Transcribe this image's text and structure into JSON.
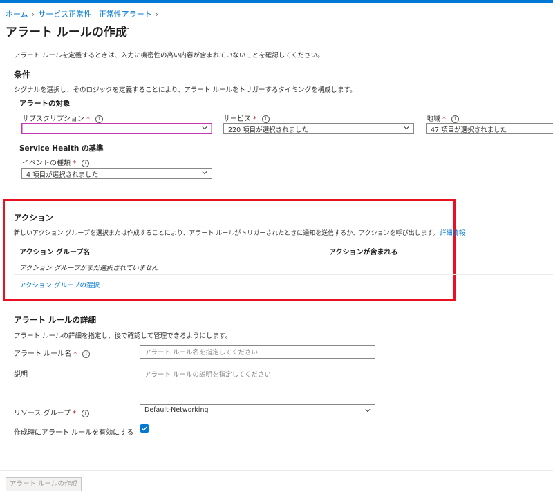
{
  "breadcrumb": {
    "home": "ホーム",
    "service_health": "サービス正常性 | 正常性アラート"
  },
  "page": {
    "title": "アラート ルールの作成",
    "more": "···",
    "intro": "アラート ルールを定義するときは、入力に機密性の高い内容が含まれていないことを確認してください。"
  },
  "condition": {
    "heading": "条件",
    "description": "シグナルを選択し、そのロジックを定義することにより、アラート ルールをトリガーするタイミングを構成します。",
    "target_heading": "アラートの対象",
    "subscription": {
      "label": "サブスクリプション",
      "value": ""
    },
    "service": {
      "label": "サービス",
      "value": "220 項目が選択されました"
    },
    "region": {
      "label": "地域",
      "value": "47 項目が選択されました"
    },
    "criteria_heading": "Service Health の基準",
    "event_type": {
      "label": "イベントの種類",
      "value": "4 項目が選択されました"
    }
  },
  "actions": {
    "heading": "アクション",
    "description": "新しいアクション グループを選択または作成することにより、アラート ルールがトリガーされたときに通知を送信するか、アクションを呼び出します。",
    "learn_more": "詳細情報",
    "col_name": "アクション グループ名",
    "col_contains": "アクションが含まれる",
    "empty": "アクション グループがまだ選択されていません",
    "select_link": "アクション グループの選択"
  },
  "details": {
    "heading": "アラート ルールの詳細",
    "description": "アラート ルールの詳細を指定し、後で確認して管理できるようにします。",
    "name_label": "アラート ルール名",
    "name_placeholder": "アラート ルール名を指定してください",
    "desc_label": "説明",
    "desc_placeholder": "アラート ルールの説明を指定してください",
    "rg_label": "リソース グループ",
    "rg_value": "Default-Networking",
    "enable_label": "作成時にアラート ルールを有効にする",
    "enable_checked": true
  },
  "footer": {
    "create_button": "アラート ルールの作成"
  },
  "labels": {
    "required": "*",
    "info": "i",
    "chevron": "›"
  },
  "colors": {
    "accent": "#0078d4",
    "highlight": "#e81123",
    "required": "#a4262c"
  }
}
